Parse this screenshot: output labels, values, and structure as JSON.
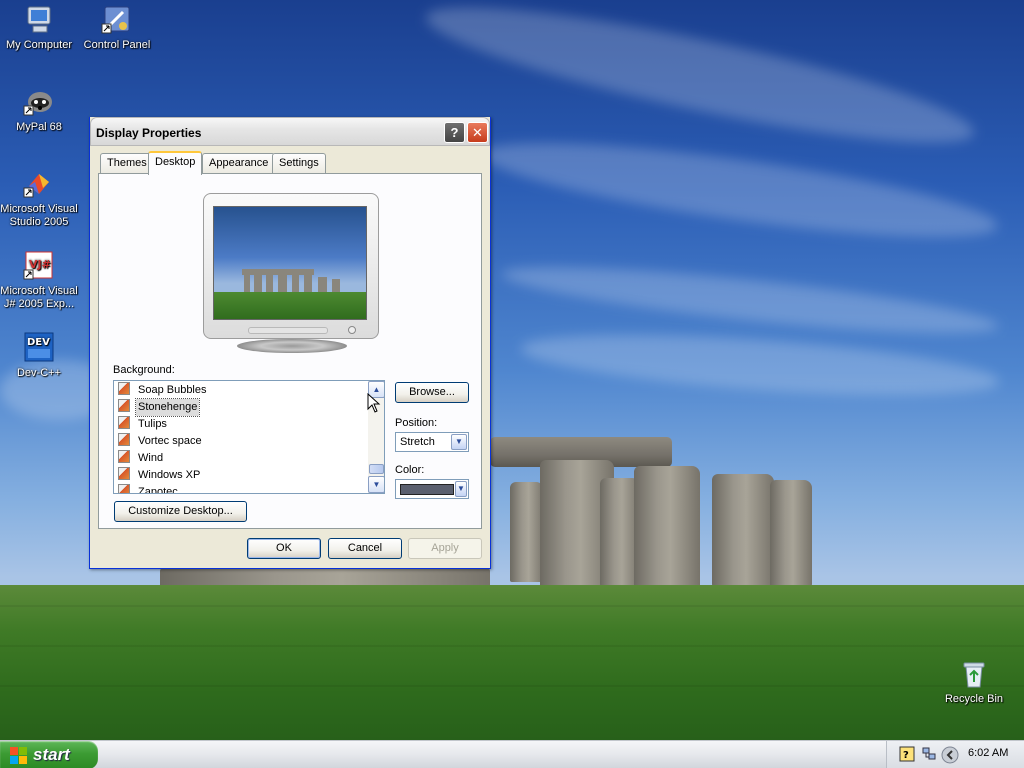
{
  "desktop": {
    "icons": [
      {
        "label": "My Computer",
        "icon": "my-computer-icon"
      },
      {
        "label": "Control Panel",
        "icon": "control-panel-icon"
      },
      {
        "label": "MyPal 68",
        "icon": "mypal-icon"
      },
      {
        "label": "Microsoft Visual Studio 2005",
        "icon": "visual-studio-icon"
      },
      {
        "label": "Microsoft Visual J# 2005 Exp...",
        "icon": "visual-jsharp-icon",
        "badge": "VJ#"
      },
      {
        "label": "Dev-C++",
        "icon": "dev-cpp-icon",
        "badge": "DEV"
      },
      {
        "label": "Recycle Bin",
        "icon": "recycle-bin-icon"
      }
    ]
  },
  "dialog": {
    "title": "Display Properties",
    "help_symbol": "?",
    "close_symbol": "✕",
    "tabs": [
      {
        "label": "Themes",
        "active": false
      },
      {
        "label": "Desktop",
        "active": true
      },
      {
        "label": "Appearance",
        "active": false
      },
      {
        "label": "Settings",
        "active": false
      }
    ],
    "background_label": "Background:",
    "backgrounds": [
      {
        "name": "Soap Bubbles",
        "selected": false
      },
      {
        "name": "Stonehenge",
        "selected": true
      },
      {
        "name": "Tulips",
        "selected": false
      },
      {
        "name": "Vortec space",
        "selected": false
      },
      {
        "name": "Wind",
        "selected": false
      },
      {
        "name": "Windows XP",
        "selected": false
      },
      {
        "name": "Zapotec",
        "selected": false
      }
    ],
    "scroll_up": "▲",
    "scroll_down": "▼",
    "browse_label": "Browse...",
    "position_label": "Position:",
    "position_value": "Stretch",
    "color_label": "Color:",
    "color_value": "#5a5f6e",
    "dropdown_arrow": "▼",
    "customize_label": "Customize Desktop...",
    "ok_label": "OK",
    "cancel_label": "Cancel",
    "apply_label": "Apply"
  },
  "taskbar": {
    "start_label": "start",
    "clock": "6:02 AM",
    "tray_icons": [
      "help-icon",
      "network-icon",
      "show-hidden-icons-icon"
    ]
  }
}
